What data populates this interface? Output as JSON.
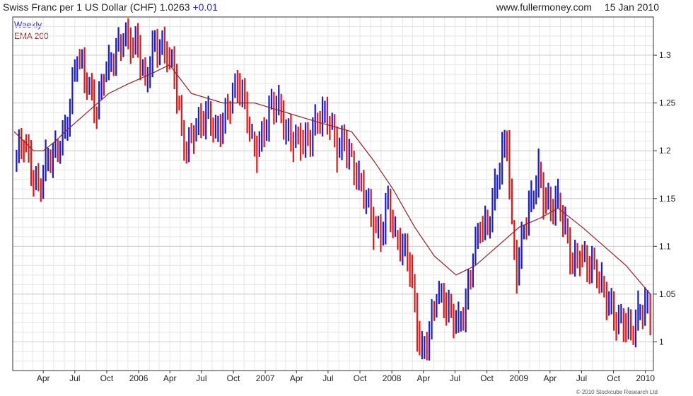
{
  "header": {
    "title": "Swiss Franc per 1 US Dollar (CHF)",
    "last": "1.0263",
    "change": "+0.01",
    "site": "www.fullermoney.com",
    "date": "15 Jan 2010"
  },
  "legend": {
    "weekly": "Weekly",
    "ema": "EMA 200"
  },
  "footer": {
    "copyright": "© 2010 Stockcube Research Ltd"
  },
  "colors": {
    "up": "#1a1ad8",
    "down": "#e01818",
    "ema": "#9a1f1f",
    "grid": "#e6e6e6",
    "axis": "#333333"
  },
  "chart_data": {
    "type": "line",
    "title": "Swiss Franc per 1 US Dollar (CHF)",
    "xlabel": "",
    "ylabel": "",
    "ylim": [
      0.97,
      1.34
    ],
    "y_ticks": [
      1,
      1.05,
      1.1,
      1.15,
      1.2,
      1.25,
      1.3
    ],
    "y_tick_labels": [
      "1",
      "1.05",
      "1.1",
      "1.15",
      "1.2",
      "1.25",
      "1.3"
    ],
    "x_tick_labels": [
      "Apr",
      "Jul",
      "Oct",
      "2006",
      "Apr",
      "Jul",
      "Oct",
      "2007",
      "Apr",
      "Jul",
      "Oct",
      "2008",
      "Apr",
      "Jul",
      "Oct",
      "2009",
      "Apr",
      "Jul",
      "Oct",
      "2010"
    ],
    "x_range": [
      "2005-01-03",
      "2010-01-24"
    ],
    "grid": true,
    "legend_position": "top-left",
    "series": [
      {
        "name": "Weekly",
        "style": "weekly-bars",
        "points": [
          [
            "2005-01-07",
            1.19
          ],
          [
            "2005-02-04",
            1.21
          ],
          [
            "2005-03-04",
            1.17
          ],
          [
            "2005-03-18",
            1.16
          ],
          [
            "2005-04-08",
            1.19
          ],
          [
            "2005-05-06",
            1.2
          ],
          [
            "2005-06-03",
            1.22
          ],
          [
            "2005-06-17",
            1.25
          ],
          [
            "2005-07-08",
            1.3
          ],
          [
            "2005-08-05",
            1.27
          ],
          [
            "2005-09-02",
            1.24
          ],
          [
            "2005-09-23",
            1.28
          ],
          [
            "2005-10-07",
            1.29
          ],
          [
            "2005-11-04",
            1.31
          ],
          [
            "2005-11-18",
            1.32
          ],
          [
            "2005-12-09",
            1.31
          ],
          [
            "2005-12-30",
            1.31
          ],
          [
            "2006-01-20",
            1.27
          ],
          [
            "2006-02-10",
            1.31
          ],
          [
            "2006-03-03",
            1.31
          ],
          [
            "2006-03-24",
            1.3
          ],
          [
            "2006-04-14",
            1.28
          ],
          [
            "2006-05-05",
            1.22
          ],
          [
            "2006-05-19",
            1.2
          ],
          [
            "2006-06-09",
            1.22
          ],
          [
            "2006-06-30",
            1.23
          ],
          [
            "2006-07-21",
            1.24
          ],
          [
            "2006-08-11",
            1.22
          ],
          [
            "2006-09-01",
            1.23
          ],
          [
            "2006-09-22",
            1.25
          ],
          [
            "2006-10-13",
            1.27
          ],
          [
            "2006-11-03",
            1.25
          ],
          [
            "2006-11-24",
            1.21
          ],
          [
            "2006-12-08",
            1.2
          ],
          [
            "2006-12-29",
            1.22
          ],
          [
            "2007-01-19",
            1.25
          ],
          [
            "2007-02-09",
            1.25
          ],
          [
            "2007-03-02",
            1.22
          ],
          [
            "2007-03-23",
            1.21
          ],
          [
            "2007-04-13",
            1.21
          ],
          [
            "2007-05-04",
            1.21
          ],
          [
            "2007-05-25",
            1.23
          ],
          [
            "2007-06-15",
            1.24
          ],
          [
            "2007-07-06",
            1.23
          ],
          [
            "2007-07-27",
            1.2
          ],
          [
            "2007-08-17",
            1.21
          ],
          [
            "2007-09-07",
            1.19
          ],
          [
            "2007-09-28",
            1.17
          ],
          [
            "2007-10-19",
            1.15
          ],
          [
            "2007-11-09",
            1.12
          ],
          [
            "2007-11-30",
            1.11
          ],
          [
            "2007-12-21",
            1.15
          ],
          [
            "2008-01-11",
            1.11
          ],
          [
            "2008-02-01",
            1.1
          ],
          [
            "2008-02-22",
            1.08
          ],
          [
            "2008-03-14",
            1.01
          ],
          [
            "2008-03-28",
            0.99
          ],
          [
            "2008-04-18",
            1.01
          ],
          [
            "2008-05-09",
            1.05
          ],
          [
            "2008-05-30",
            1.04
          ],
          [
            "2008-06-20",
            1.03
          ],
          [
            "2008-07-11",
            1.02
          ],
          [
            "2008-08-01",
            1.04
          ],
          [
            "2008-08-22",
            1.09
          ],
          [
            "2008-09-12",
            1.12
          ],
          [
            "2008-10-03",
            1.12
          ],
          [
            "2008-10-24",
            1.16
          ],
          [
            "2008-11-14",
            1.2
          ],
          [
            "2008-11-28",
            1.21
          ],
          [
            "2008-12-12",
            1.12
          ],
          [
            "2008-12-26",
            1.07
          ],
          [
            "2009-01-16",
            1.12
          ],
          [
            "2009-02-06",
            1.15
          ],
          [
            "2009-02-27",
            1.18
          ],
          [
            "2009-03-13",
            1.15
          ],
          [
            "2009-04-03",
            1.14
          ],
          [
            "2009-04-24",
            1.15
          ],
          [
            "2009-05-15",
            1.12
          ],
          [
            "2009-06-05",
            1.08
          ],
          [
            "2009-06-26",
            1.09
          ],
          [
            "2009-07-17",
            1.08
          ],
          [
            "2009-08-07",
            1.08
          ],
          [
            "2009-08-28",
            1.06
          ],
          [
            "2009-09-18",
            1.04
          ],
          [
            "2009-10-09",
            1.02
          ],
          [
            "2009-10-30",
            1.02
          ],
          [
            "2009-11-20",
            1.01
          ],
          [
            "2009-12-11",
            1.03
          ],
          [
            "2009-12-31",
            1.04
          ],
          [
            "2010-01-15",
            1.0263
          ]
        ]
      },
      {
        "name": "EMA 200",
        "style": "line",
        "points": [
          [
            "2005-01-07",
            1.22
          ],
          [
            "2005-03-04",
            1.2
          ],
          [
            "2005-04-01",
            1.2
          ],
          [
            "2005-05-06",
            1.21
          ],
          [
            "2005-06-03",
            1.22
          ],
          [
            "2005-08-05",
            1.24
          ],
          [
            "2005-10-07",
            1.26
          ],
          [
            "2005-12-02",
            1.27
          ],
          [
            "2006-02-03",
            1.28
          ],
          [
            "2006-03-31",
            1.29
          ],
          [
            "2006-06-02",
            1.26
          ],
          [
            "2006-09-01",
            1.25
          ],
          [
            "2006-12-01",
            1.25
          ],
          [
            "2007-03-02",
            1.24
          ],
          [
            "2007-06-01",
            1.23
          ],
          [
            "2007-09-07",
            1.22
          ],
          [
            "2007-11-09",
            1.19
          ],
          [
            "2008-01-04",
            1.16
          ],
          [
            "2008-03-07",
            1.12
          ],
          [
            "2008-05-02",
            1.09
          ],
          [
            "2008-07-04",
            1.07
          ],
          [
            "2008-08-29",
            1.08
          ],
          [
            "2008-10-31",
            1.1
          ],
          [
            "2009-01-02",
            1.12
          ],
          [
            "2009-03-06",
            1.13
          ],
          [
            "2009-04-24",
            1.14
          ],
          [
            "2009-07-03",
            1.12
          ],
          [
            "2009-09-04",
            1.1
          ],
          [
            "2009-11-06",
            1.08
          ],
          [
            "2010-01-15",
            1.05
          ]
        ]
      }
    ]
  }
}
